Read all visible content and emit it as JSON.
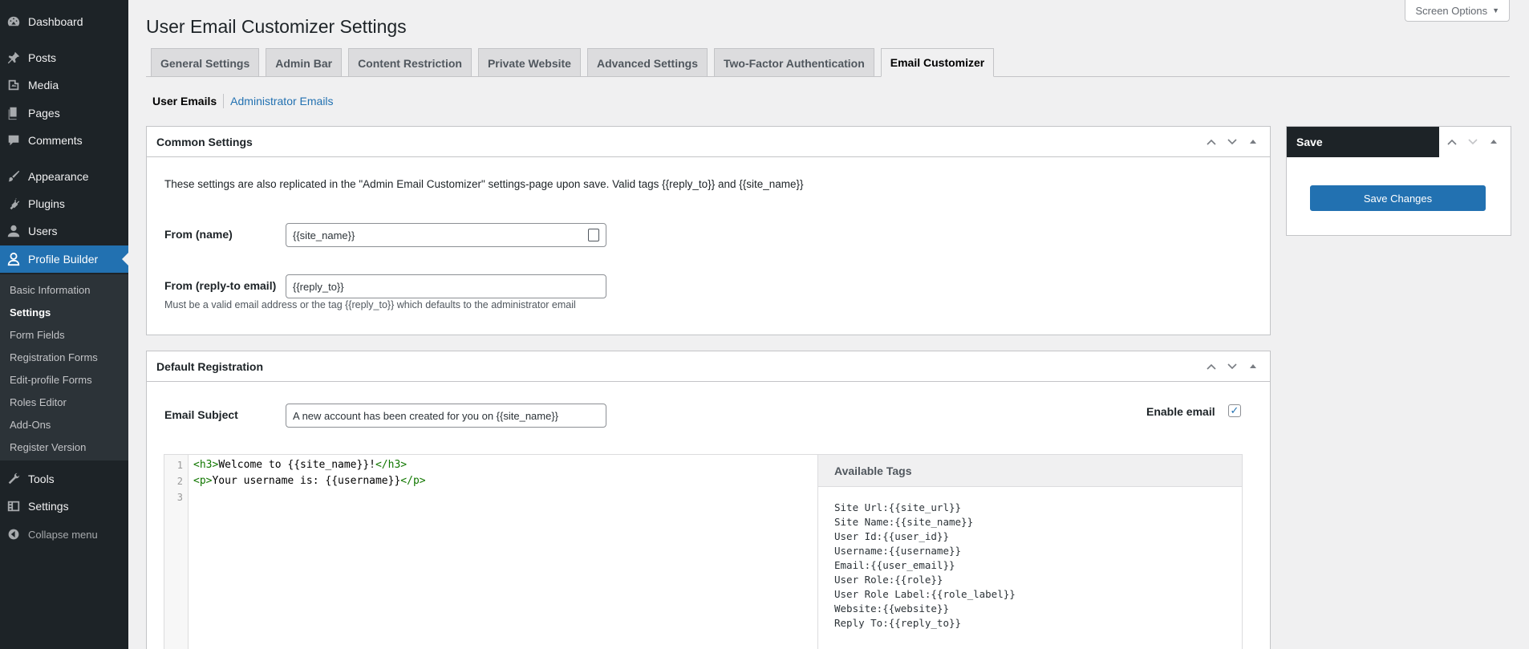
{
  "sidebar": {
    "items": [
      {
        "label": "Dashboard",
        "icon": "dashboard-icon"
      },
      {
        "label": "Posts",
        "icon": "pin-icon"
      },
      {
        "label": "Media",
        "icon": "media-icon"
      },
      {
        "label": "Pages",
        "icon": "pages-icon"
      },
      {
        "label": "Comments",
        "icon": "comment-icon"
      },
      {
        "label": "Appearance",
        "icon": "brush-icon"
      },
      {
        "label": "Plugins",
        "icon": "plugin-icon"
      },
      {
        "label": "Users",
        "icon": "user-icon"
      },
      {
        "label": "Profile Builder",
        "icon": "profile-icon"
      },
      {
        "label": "Tools",
        "icon": "wrench-icon"
      },
      {
        "label": "Settings",
        "icon": "settings-icon"
      },
      {
        "label": "Collapse menu",
        "icon": "collapse-icon"
      }
    ],
    "submenu": [
      "Basic Information",
      "Settings",
      "Form Fields",
      "Registration Forms",
      "Edit-profile Forms",
      "Roles Editor",
      "Add-Ons",
      "Register Version"
    ]
  },
  "header": {
    "title": "User Email Customizer Settings",
    "screen_options": "Screen Options"
  },
  "tabs": [
    "General Settings",
    "Admin Bar",
    "Content Restriction",
    "Private Website",
    "Advanced Settings",
    "Two-Factor Authentication",
    "Email Customizer"
  ],
  "subnav": {
    "current": "User Emails",
    "other": "Administrator Emails"
  },
  "common": {
    "title": "Common Settings",
    "description": "These settings are also replicated in the \"Admin Email Customizer\" settings-page upon save. Valid tags {{reply_to}} and {{site_name}}",
    "from_name_label": "From (name)",
    "from_name_value": "{{site_name}}",
    "reply_label": "From (reply-to email)",
    "reply_value": "{{reply_to}}",
    "reply_desc": "Must be a valid email address or the tag {{reply_to}} which defaults to the administrator email"
  },
  "registration": {
    "title": "Default Registration",
    "subject_label": "Email Subject",
    "subject_value": "A new account has been created for you on {{site_name}}",
    "enable_label": "Enable email",
    "enabled": true,
    "lines": [
      "1",
      "2",
      "3"
    ],
    "code": {
      "l1_open": "<h3>",
      "l1_text": "Welcome to {{site_name}}!",
      "l1_close": "</h3>",
      "l2_open": "<p>",
      "l2_text": "Your username is: {{username}}",
      "l2_close": "</p>"
    },
    "tags_title": "Available Tags",
    "tags": [
      "Site Url:{{site_url}}",
      "Site Name:{{site_name}}",
      "User Id:{{user_id}}",
      "Username:{{username}}",
      "Email:{{user_email}}",
      "User Role:{{role}}",
      "User Role Label:{{role_label}}",
      "Website:{{website}}",
      "Reply To:{{reply_to}}"
    ]
  },
  "save": {
    "title": "Save",
    "button": "Save Changes"
  },
  "colors": {
    "accent": "#2271b1",
    "sidebar": "#1d2327"
  }
}
